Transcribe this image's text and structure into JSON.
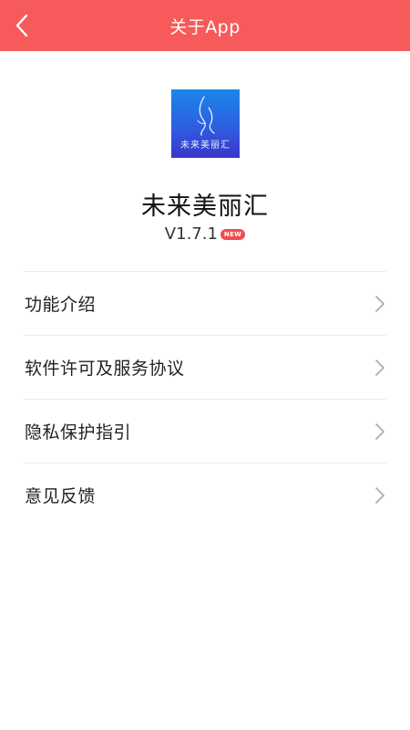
{
  "header": {
    "title": "关于App",
    "back_icon": "chevron-left-icon",
    "color": "#f75a5a"
  },
  "app": {
    "logo_text": "未来美丽汇",
    "name": "未来美丽汇",
    "version": "V1.7.1",
    "badge": "NEW",
    "logo_colors": [
      "#1a86e8",
      "#3a35c8"
    ]
  },
  "menu": {
    "items": [
      {
        "label": "功能介绍",
        "icon": "chevron-right-icon"
      },
      {
        "label": "软件许可及服务协议",
        "icon": "chevron-right-icon"
      },
      {
        "label": "隐私保护指引",
        "icon": "chevron-right-icon"
      },
      {
        "label": "意见反馈",
        "icon": "chevron-right-icon"
      }
    ]
  }
}
